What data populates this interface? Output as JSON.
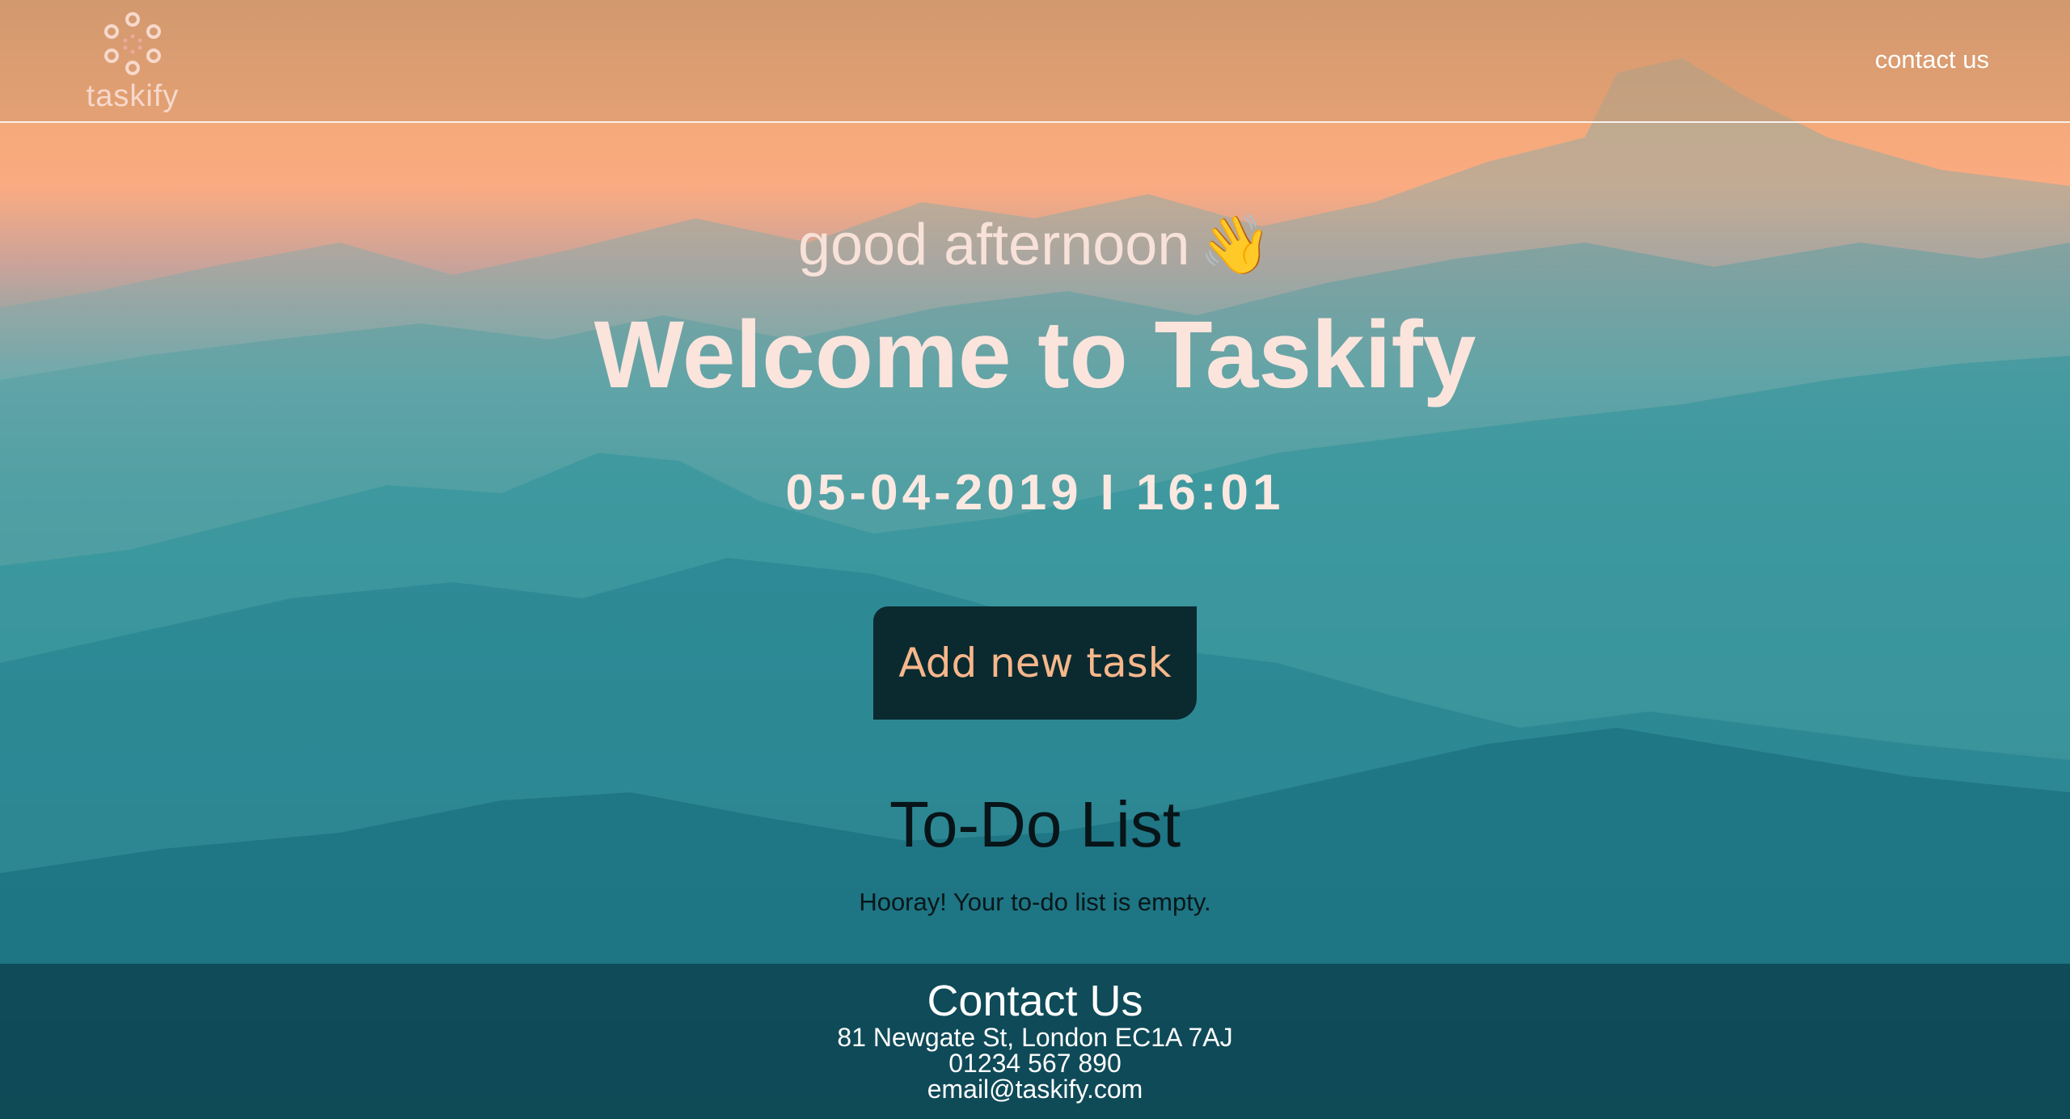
{
  "header": {
    "logo_text": "taskify",
    "contact_link": "contact us"
  },
  "hero": {
    "greeting": "good afternoon",
    "greeting_emoji": "👋",
    "title": "Welcome to Taskify",
    "date": "05-04-2019",
    "separator": "I",
    "time": "16:01"
  },
  "actions": {
    "add_task_label": "Add new task"
  },
  "todo": {
    "title": "To-Do List",
    "empty_message": "Hooray! Your to-do list is empty."
  },
  "footer": {
    "title": "Contact Us",
    "address": "81 Newgate St, London EC1A 7AJ",
    "phone": "01234 567 890",
    "email": "email@taskify.com"
  },
  "colors": {
    "button_bg": "#0b2a30",
    "button_text": "#f7b78b",
    "logo": "#f7d8cc"
  }
}
